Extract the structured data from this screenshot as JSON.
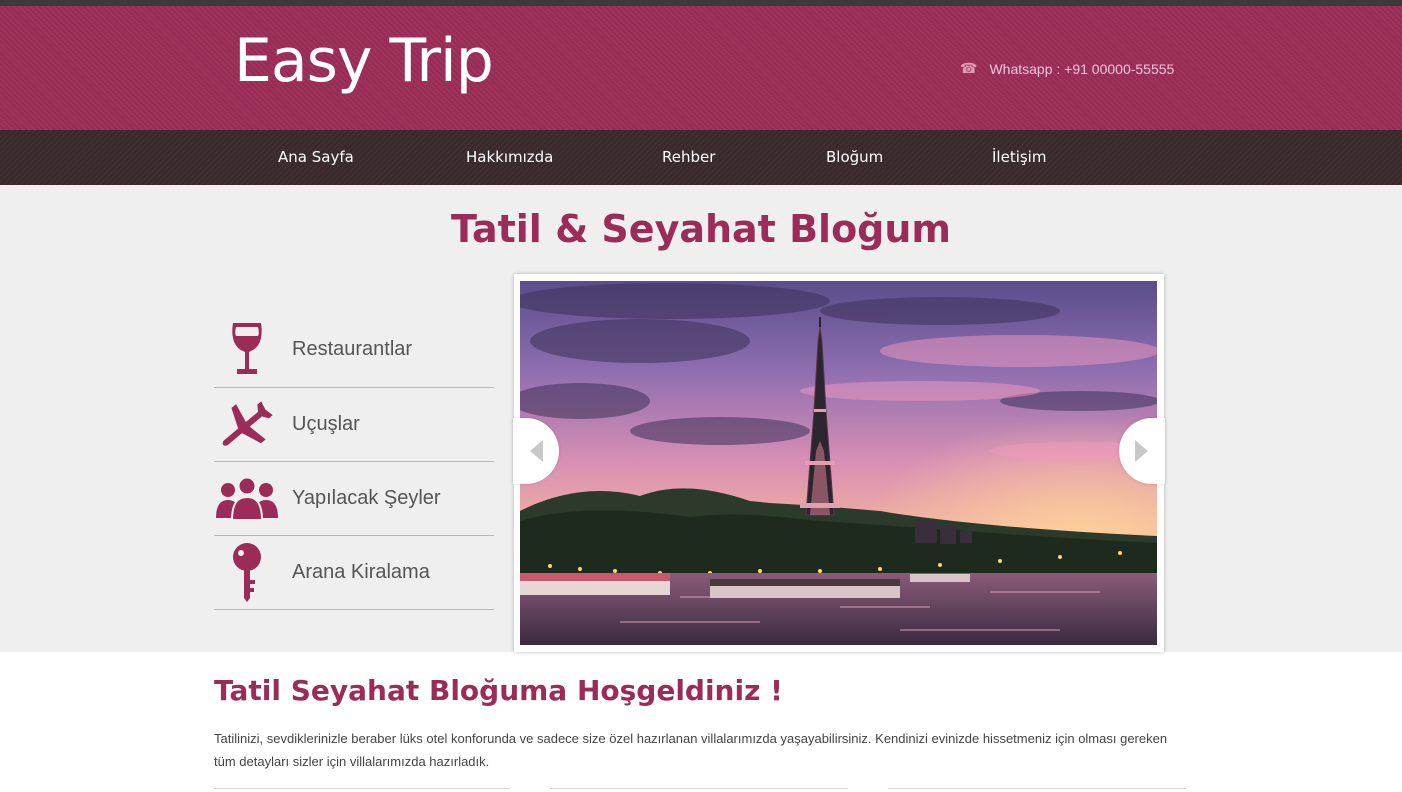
{
  "header": {
    "logo": "Easy Trip",
    "contact_icon": "phone-icon",
    "contact_text": "Whatsapp : +91 00000-55555"
  },
  "nav": {
    "items": [
      "Ana Sayfa",
      "Hakkımızda",
      "Rehber",
      "Bloğum",
      "İletişim"
    ]
  },
  "hero": {
    "title": "Tatil & Seyahat Bloğum",
    "categories": [
      {
        "label": "Restaurantlar",
        "icon": "wine-glass-icon"
      },
      {
        "label": "Uçuşlar",
        "icon": "airplane-icon"
      },
      {
        "label": "Yapılacak Şeyler",
        "icon": "people-icon"
      },
      {
        "label": "Arana Kiralama",
        "icon": "key-icon"
      }
    ],
    "slider": {
      "image": "eiffel-tower-sunset-photo",
      "prev_icon": "arrow-left-icon",
      "next_icon": "arrow-right-icon"
    }
  },
  "welcome": {
    "title": "Tatil Seyahat Bloğuma Hoşgeldiniz !",
    "text": "Tatilinizi, sevdiklerinizle beraber lüks otel konforunda ve sadece size özel hazırlanan villalarımızda yaşayabilirsiniz. Kendinizi evinizde hissetmeniz için olması gereken tüm detayları sizler için villalarımızda hazırladık."
  },
  "colors": {
    "brand": "#9b2c57",
    "nav_bg": "#3a2a2c",
    "hero_bg": "#efefef"
  }
}
